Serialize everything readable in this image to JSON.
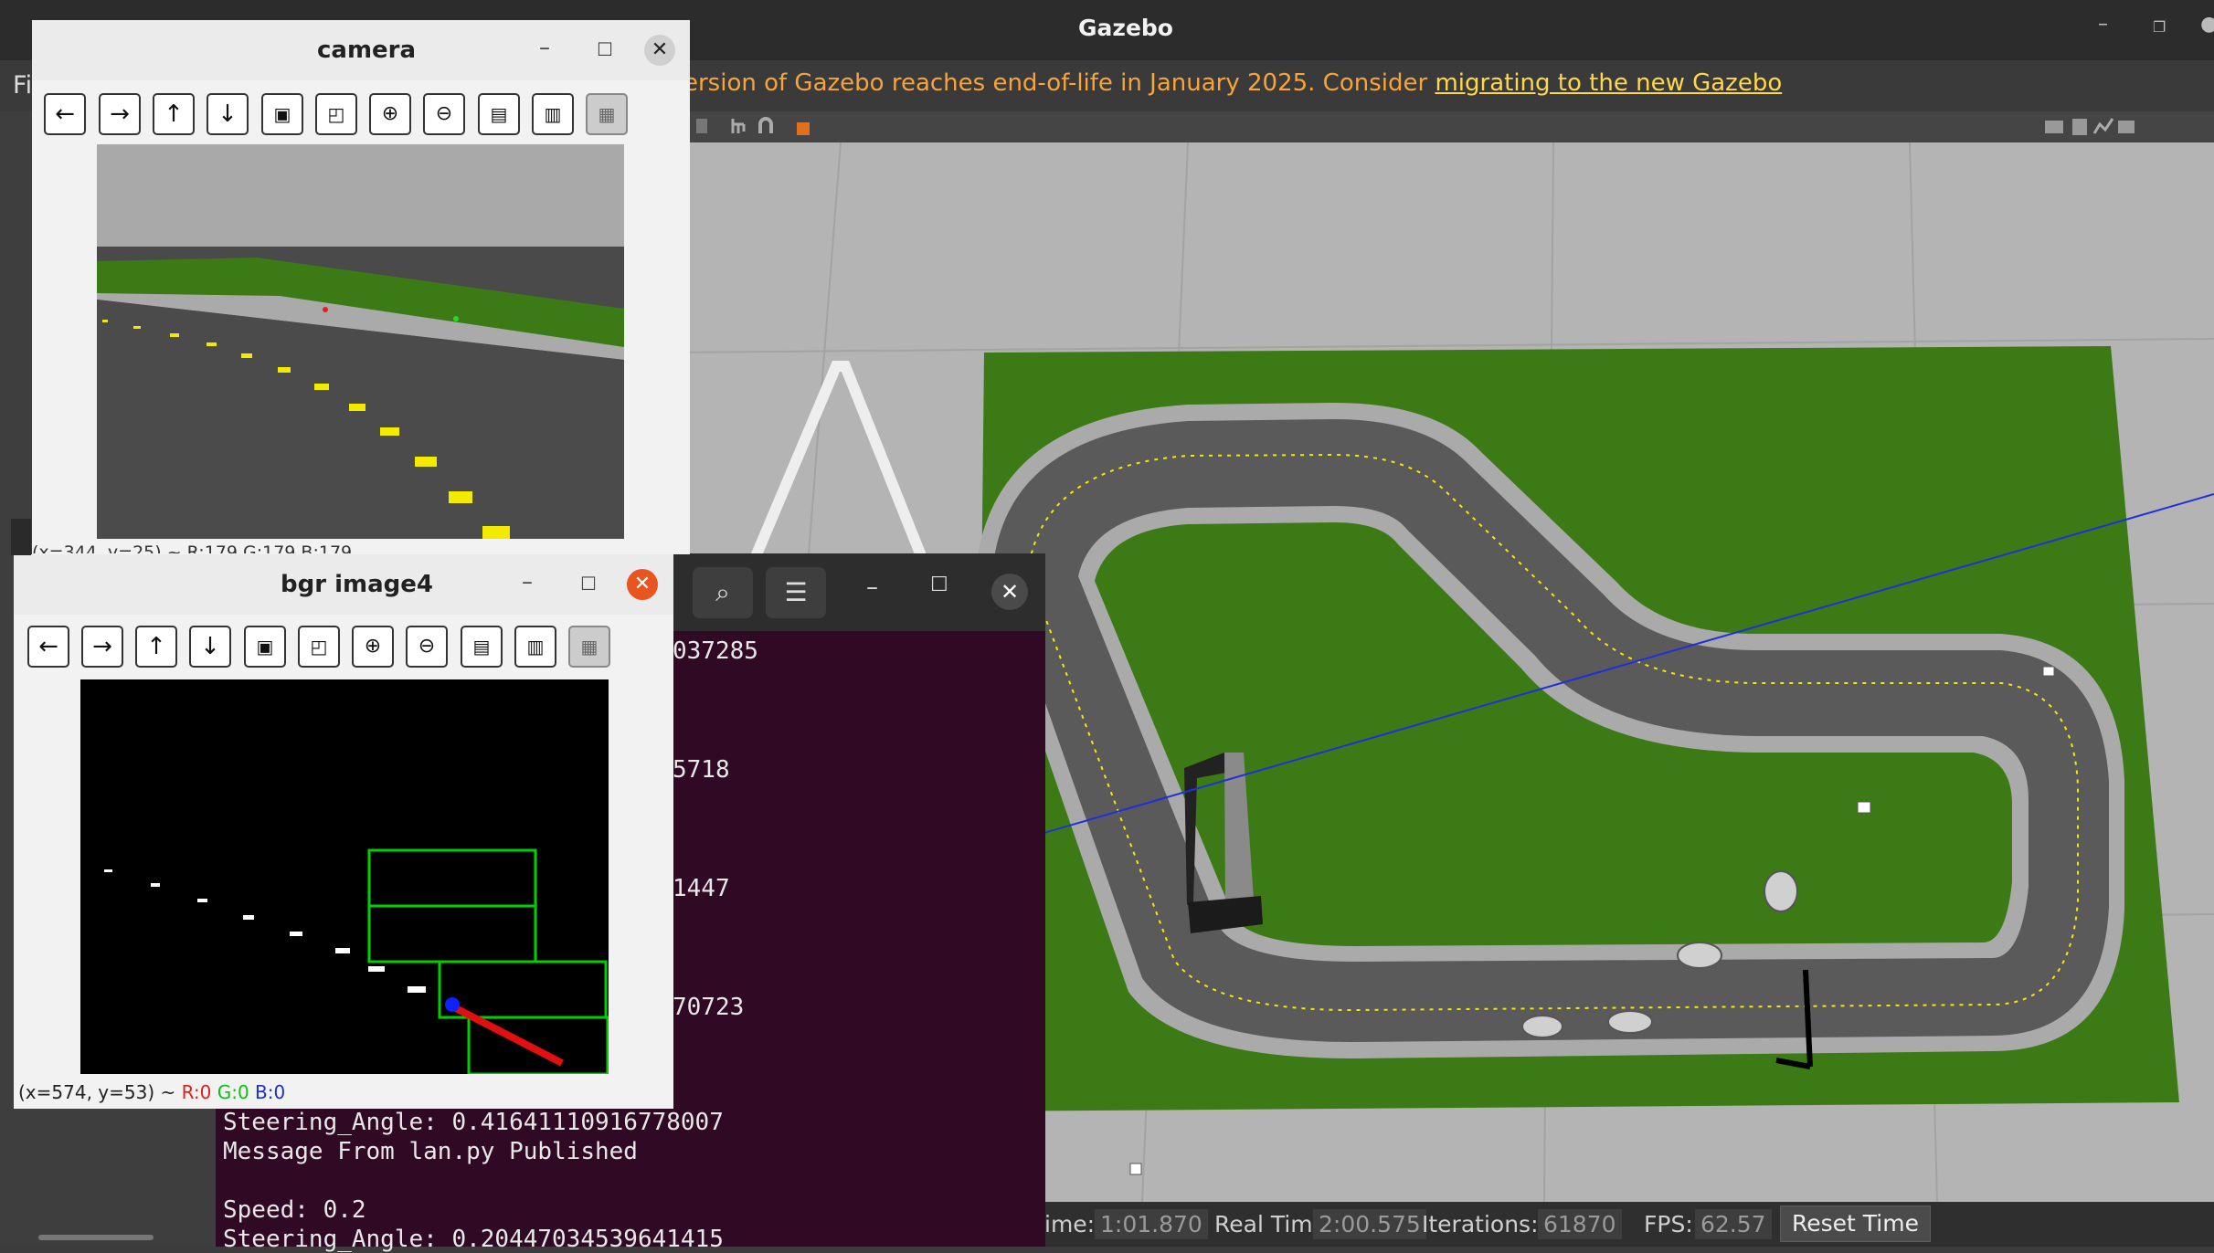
{
  "gazebo": {
    "title": "Gazebo",
    "menu_first": "Fi",
    "warning_text": "ersion of Gazebo reaches end-of-life in January 2025. Consider ",
    "warning_link": "migrating to the new Gazebo",
    "status": {
      "sim_time_label": "ime:",
      "sim_time": "1:01.870",
      "real_time_label": "Real Time:",
      "real_time": "2:00.575",
      "iterations_label": "Iterations:",
      "iterations": "61870",
      "fps_label": "FPS:",
      "fps": "62.57",
      "reset_label": "Reset Time"
    }
  },
  "terminal": {
    "lines": [
      "037285",
      "5718",
      "1447",
      "70723",
      "Steering_Angle: 0.41641110916778007",
      "Message From lan.py Published",
      "Speed: 0.2",
      "Steering_Angle: 0.20447034539641415"
    ]
  },
  "camera_window": {
    "title": "camera",
    "status_partial": "(x=344, y=25) ~ R:179 G:179 B:179"
  },
  "bgr_window": {
    "title": "bgr image4",
    "coord": "(x=574, y=53) ~",
    "r": "R:0",
    "g": "G:0",
    "b": "B:0"
  },
  "toolbar_icons": [
    "arrow-left-icon",
    "arrow-right-icon",
    "arrow-up-icon",
    "arrow-down-icon",
    "image-icon",
    "image-zoom-icon",
    "zoom-in-icon",
    "zoom-out-icon",
    "save-icon",
    "clipboard-icon",
    "properties-icon"
  ],
  "colors": {
    "warning": "#f7a43a",
    "terminal_bg": "#300a24",
    "close_red": "#e95420",
    "grass": "#3c7a16",
    "lane_yellow": "#f4ea00",
    "box_green": "#00d000"
  }
}
